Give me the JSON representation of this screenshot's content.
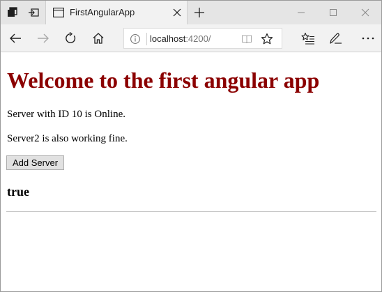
{
  "tab": {
    "title": "FirstAngularApp"
  },
  "address_bar": {
    "host": "localhost",
    "port": ":4200/"
  },
  "page": {
    "heading": "Welcome to the first angular app",
    "server_status": "Server with ID 10 is Online.",
    "server2_status": "Server2 is also working fine.",
    "add_server_label": "Add Server",
    "flag_value": "true"
  },
  "icons": {
    "titlebar": [
      "tab-actions-icon",
      "set-aside-tabs-icon",
      "page-icon",
      "close-icon",
      "new-tab-icon",
      "minimize-icon",
      "maximize-icon",
      "window-close-icon"
    ],
    "navbar": [
      "back-icon",
      "forward-icon",
      "refresh-icon",
      "home-icon",
      "info-icon",
      "reading-view-icon",
      "favorite-star-icon",
      "favorites-hub-icon",
      "pen-icon",
      "more-icon"
    ]
  },
  "colors": {
    "heading": "#8b0000",
    "tabbar": "#e5e5e5",
    "navbar": "#f2f2f2"
  }
}
